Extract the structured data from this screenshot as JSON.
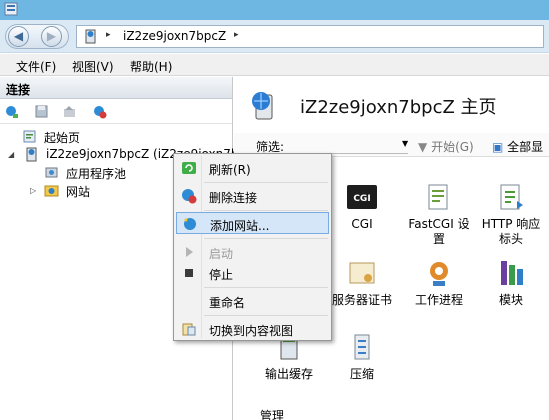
{
  "window": {
    "app_icon": "iis-manager-icon"
  },
  "address": {
    "crumb": "iZ2ze9joxn7bpcZ",
    "separator": "▸"
  },
  "menubar": {
    "file": "文件(F)",
    "view": "视图(V)",
    "help": "帮助(H)"
  },
  "connections": {
    "title": "连接",
    "tree": {
      "start_page": "起始页",
      "server": "iZ2ze9joxn7bpcZ (iZ2ze9joxn7b",
      "app_pools": "应用程序池",
      "sites": "网站"
    }
  },
  "home": {
    "title": "iZ2ze9joxn7bpcZ 主页",
    "filter_label": "筛选:",
    "start_label": "开始(G)",
    "show_all_label": "全部显",
    "features": {
      "cgi_badge": "CGI",
      "cgi": "CGI",
      "fastcgi": "FastCGI 设置",
      "http_headers": "HTTP 响应标头",
      "server_certs": "服务器证书",
      "worker_processes": "工作进程",
      "modules": "模块",
      "output_cache": "输出缓存",
      "compression": "压缩"
    },
    "group_management": "管理"
  },
  "context_menu": {
    "refresh": "刷新(R)",
    "remove_connection": "删除连接",
    "add_website": "添加网站...",
    "start": "启动",
    "stop": "停止",
    "rename": "重命名",
    "switch_content_view": "切换到内容视图"
  },
  "colors": {
    "titlebar": "#6fb7e3",
    "menu_highlight": "#d5e6f8",
    "menu_highlight_border": "#79aae2"
  }
}
